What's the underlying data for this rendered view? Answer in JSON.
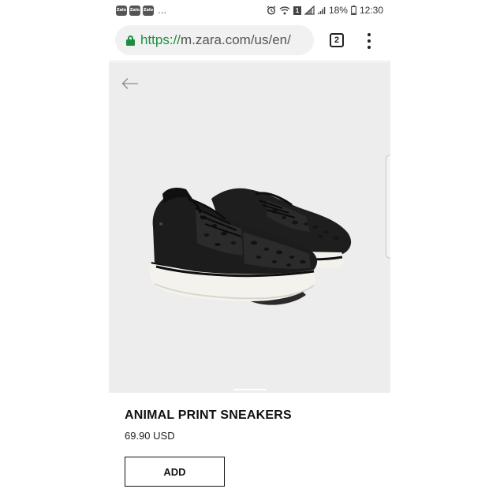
{
  "status_bar": {
    "notifications": [
      "Zalo",
      "Zalo",
      "Zalo"
    ],
    "overflow": "...",
    "sim_label": "1",
    "battery_percent": "18%",
    "time": "12:30",
    "icons": [
      "alarm-icon",
      "wifi-icon",
      "signal-icon",
      "battery-icon"
    ]
  },
  "browser": {
    "url_scheme": "https://",
    "url_rest": "m.zara.com/us/en/",
    "tab_count": "2",
    "icons": [
      "lock-icon",
      "tabs-icon",
      "overflow-menu-icon"
    ]
  },
  "product": {
    "image_alt": "black leopard print sneakers",
    "title": "ANIMAL PRINT SNEAKERS",
    "price": "69.90 USD",
    "add_label": "ADD"
  },
  "colors": {
    "secure_green": "#1e8e3e",
    "image_background": "#ededed",
    "text": "#111111"
  }
}
